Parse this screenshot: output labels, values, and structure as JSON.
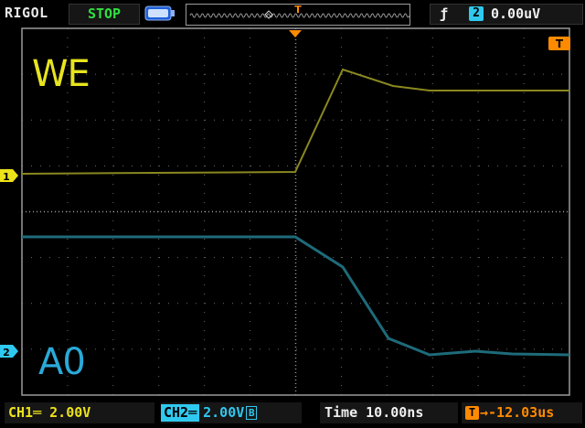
{
  "header": {
    "brand": "RIGOL",
    "run_state": "STOP",
    "trigger_marker": "T",
    "trigger_edge_symbol": "ƒ",
    "trigger_source": "2",
    "trigger_level": "0.00uV"
  },
  "screen": {
    "trace_labels": {
      "ch1": "WE",
      "ch2": "A0"
    },
    "ground_markers": {
      "ch1": "1",
      "ch2": "2"
    },
    "trigger_level_marker": "T"
  },
  "footer": {
    "ch1_label": "CH1═ 2.00V",
    "ch2_tag": "CH2═",
    "ch2_scale": "2.00V",
    "ch2_bw_flag": "B",
    "timebase": "Time 10.00ns",
    "offset_tag": "T",
    "offset_value": "→-12.03us"
  },
  "colors": {
    "ch1": "#e8e41e",
    "ch2": "#2aa9d8",
    "trigger": "#ff8a00",
    "grid": "#7a7a7a",
    "run_state": "#30e040"
  },
  "icons": [
    "battery-icon",
    "trigger-rising-edge-icon",
    "trigger-position-marker-icon",
    "ground-reference-icon"
  ]
}
